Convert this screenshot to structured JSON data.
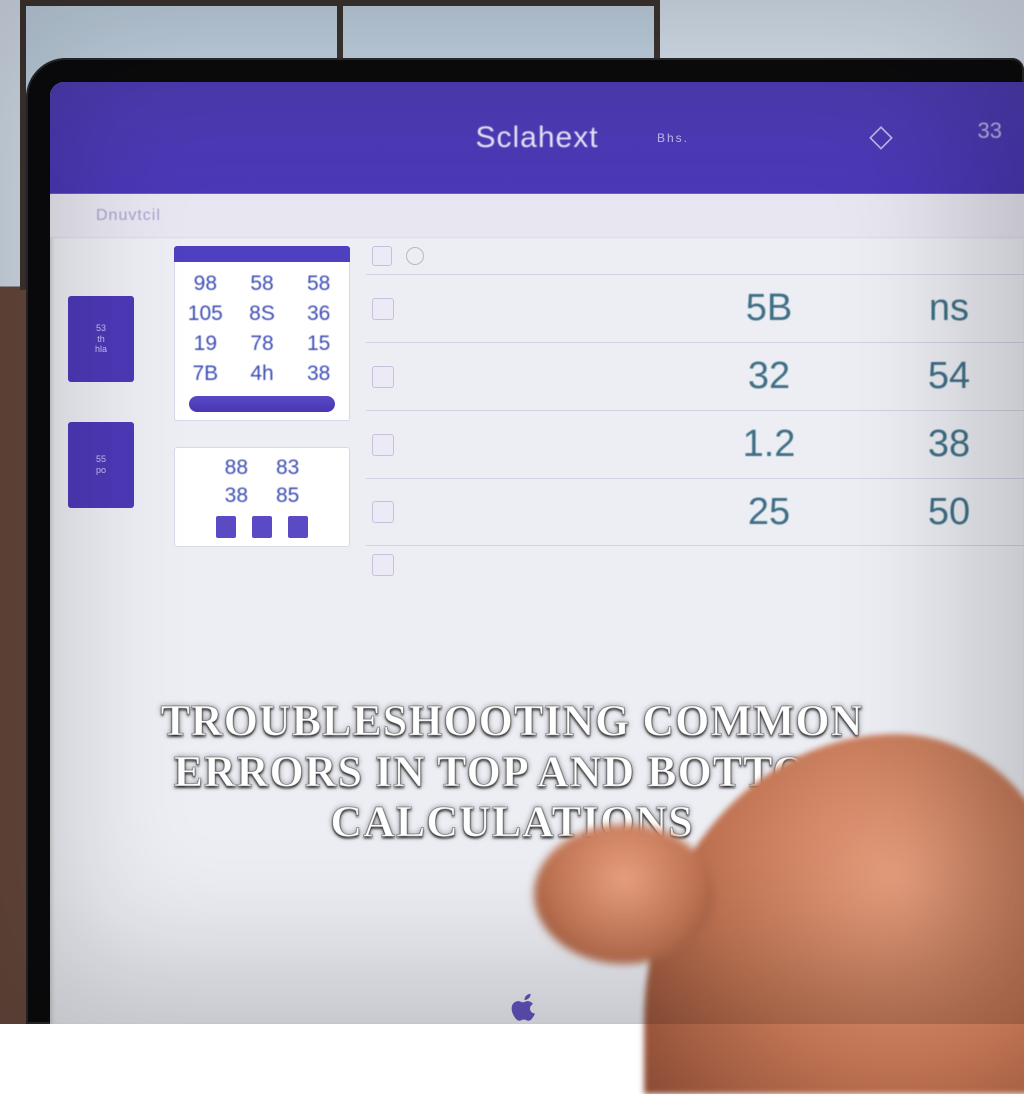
{
  "header": {
    "title": "Sclahext",
    "subtitle": "Bhs.",
    "corner_glyph": "33"
  },
  "subheader": {
    "label": "Dnuvtcil"
  },
  "sidebar": {
    "items": [
      {
        "line1": "53",
        "line2": "th",
        "line3": "hla"
      },
      {
        "line1": "55",
        "line2": "po",
        "line3": ""
      }
    ]
  },
  "panel_a": {
    "numpad": [
      "98",
      "58",
      "58",
      "105",
      "8S",
      "36",
      "19",
      "78",
      "15",
      "7B",
      "4h",
      "38"
    ]
  },
  "panel_b": {
    "cells": [
      "88",
      "83",
      "38",
      "85"
    ]
  },
  "table": {
    "rows": [
      {
        "a": "5B",
        "b": "ns"
      },
      {
        "a": "32",
        "b": "54"
      },
      {
        "a": "1.2",
        "b": "38"
      },
      {
        "a": "25",
        "b": "50"
      }
    ]
  },
  "caption": "TROUBLESHOOTING COMMON ERRORS IN TOP AND BOTTOM CALCULATIONS"
}
